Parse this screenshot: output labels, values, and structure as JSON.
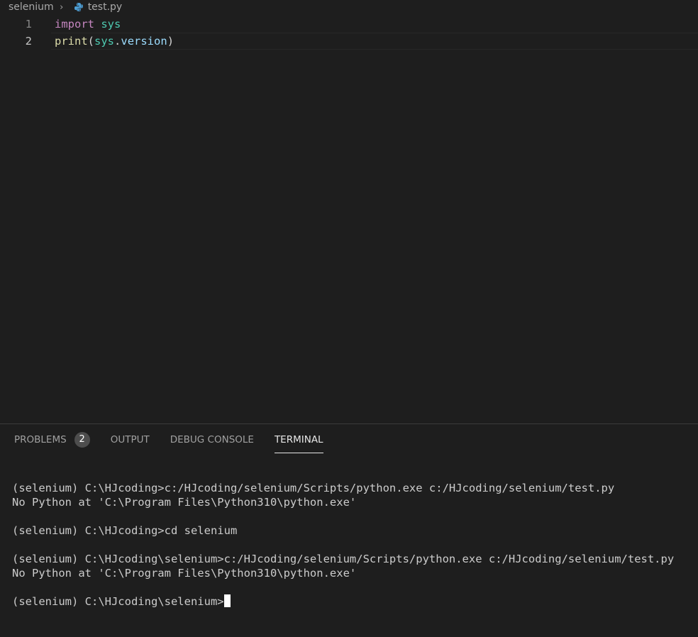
{
  "breadcrumb": {
    "folder": "selenium",
    "file": "test.py",
    "file_icon": "python-icon"
  },
  "editor": {
    "lines": [
      {
        "num": "1",
        "tokens": [
          "import",
          "sys"
        ]
      },
      {
        "num": "2",
        "tokens": [
          "print",
          "(",
          "sys",
          ".",
          "version",
          ")"
        ]
      }
    ]
  },
  "panel": {
    "tabs": [
      {
        "label": "PROBLEMS",
        "badge": "2"
      },
      {
        "label": "OUTPUT"
      },
      {
        "label": "DEBUG CONSOLE"
      },
      {
        "label": "TERMINAL",
        "active": true
      }
    ]
  },
  "terminal": {
    "lines": [
      "(selenium) C:\\HJcoding>c:/HJcoding/selenium/Scripts/python.exe c:/HJcoding/selenium/test.py",
      "No Python at 'C:\\Program Files\\Python310\\python.exe'",
      "",
      "(selenium) C:\\HJcoding>cd selenium",
      "",
      "(selenium) C:\\HJcoding\\selenium>c:/HJcoding/selenium/Scripts/python.exe c:/HJcoding/selenium/test.py",
      "No Python at 'C:\\Program Files\\Python310\\python.exe'",
      "",
      "(selenium) C:\\HJcoding\\selenium>"
    ]
  },
  "colors": {
    "background": "#1e1e1e",
    "keyword": "#c586c0",
    "module": "#4ec9b0",
    "function": "#dcdcaa",
    "variable": "#9cdcfe"
  }
}
